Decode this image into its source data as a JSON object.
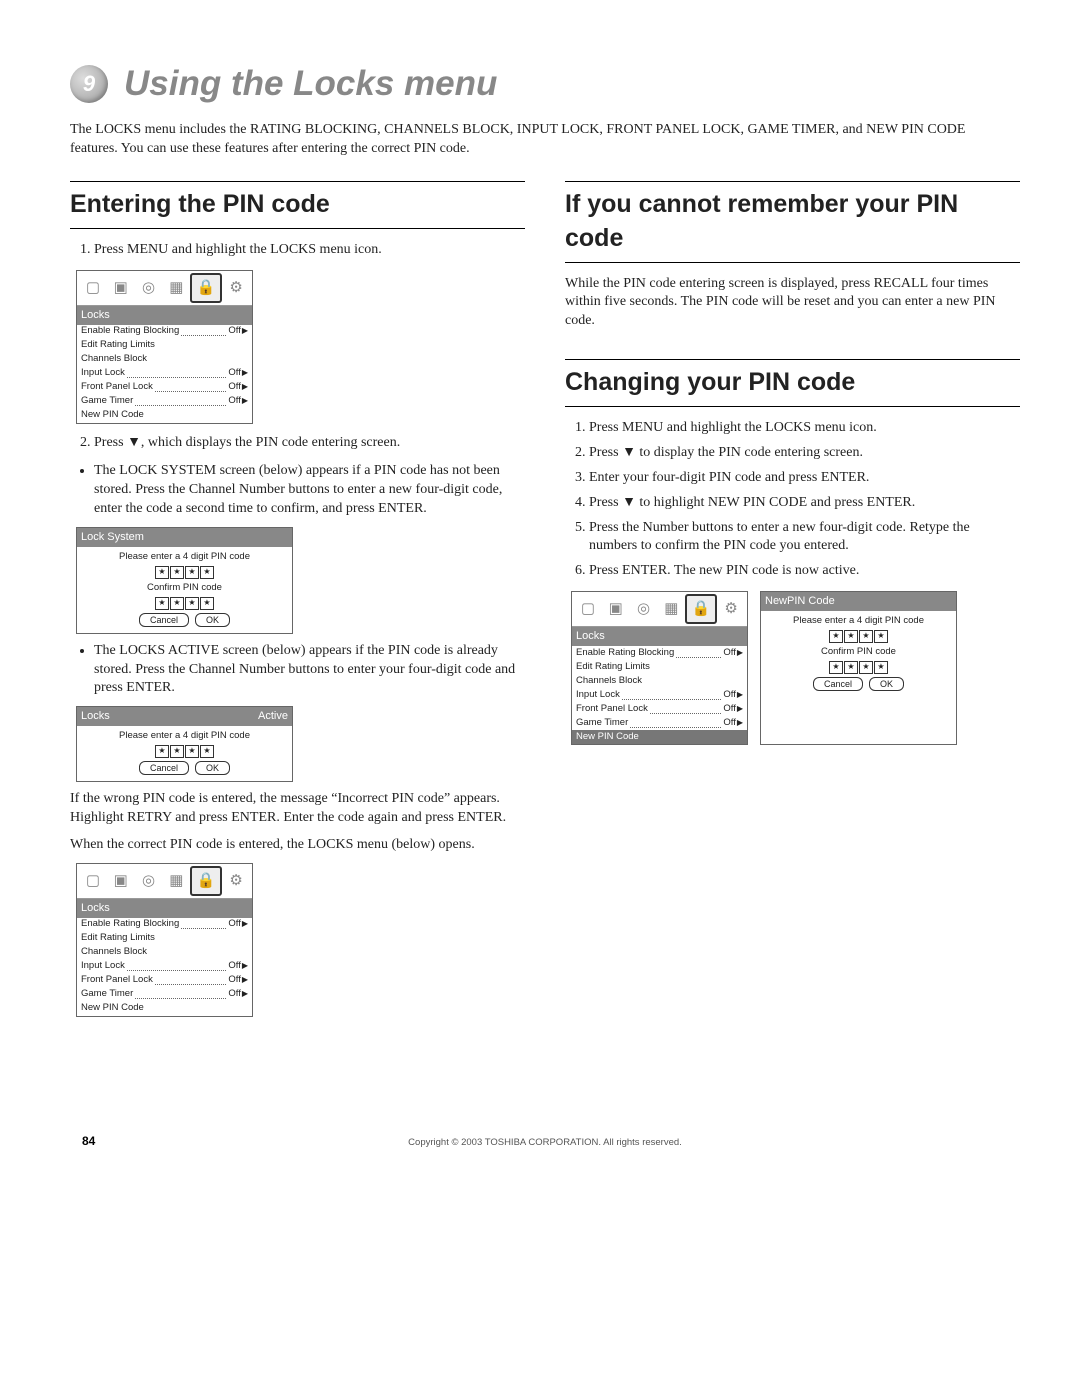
{
  "chapter": {
    "num": "9",
    "title": "Using the Locks menu"
  },
  "intro": "The LOCKS menu includes the RATING BLOCKING, CHANNELS BLOCK, INPUT LOCK, FRONT PANEL LOCK, GAME TIMER, and NEW PIN CODE features. You can use these features after entering the correct PIN code.",
  "left": {
    "h": "Entering the PIN code",
    "s1": "Press MENU and highlight the LOCKS menu icon.",
    "s2a": "Press ",
    "s2b": ", which displays the PIN code entering screen.",
    "b1": "The LOCK SYSTEM screen (below) appears if a PIN code has not been stored. Press the Channel Number buttons to enter a new four-digit code, enter the code a second time to confirm, and press ENTER.",
    "b2": "The LOCKS ACTIVE screen (below) appears if the PIN code is already stored. Press the Channel Number buttons to enter your four-digit code and press ENTER.",
    "p1": "If the wrong PIN code is entered, the message “Incorrect PIN code” appears. Highlight RETRY and press ENTER. Enter the code again and press ENTER.",
    "p2": "When the correct PIN code is entered, the LOCKS menu (below) opens."
  },
  "right": {
    "h1": "If you cannot remember your PIN code",
    "p1": "While the PIN code entering screen is displayed, press RECALL four times within five seconds. The PIN code will be reset and you can enter a new PIN code.",
    "h2": "Changing your PIN code",
    "s1": "Press MENU and highlight the LOCKS menu icon.",
    "s2a": "Press ",
    "s2b": " to display the PIN code entering screen.",
    "s3": "Enter your four-digit PIN code and press ENTER.",
    "s4a": "Press ",
    "s4b": " to highlight NEW PIN CODE and press ENTER.",
    "s5": "Press the Number buttons to enter a new four-digit code. Retype the numbers to confirm the PIN code you entered.",
    "s6": "Press ENTER. The new PIN code is now active."
  },
  "menu": {
    "title": "Locks",
    "active": "Active",
    "newpin_title": "NewPIN Code",
    "rows": {
      "r0l": "Enable Rating Blocking",
      "r0v": "Off",
      "r1l": "Edit Rating Limits",
      "r2l": "Channels Block",
      "r3l": "Input Lock",
      "r3v": "Off",
      "r4l": "Front Panel Lock",
      "r4v": "Off",
      "r5l": "Game Timer",
      "r5v": "Off",
      "r6l": "New PIN Code"
    }
  },
  "pin": {
    "lock_system": "Lock System",
    "prompt": "Please enter a 4 digit PIN code",
    "confirm": "Confirm PIN code",
    "star": "★",
    "cancel": "Cancel",
    "ok": "OK"
  },
  "footer": {
    "copy": "Copyright © 2003 TOSHIBA CORPORATION. All rights reserved.",
    "page": "84"
  }
}
